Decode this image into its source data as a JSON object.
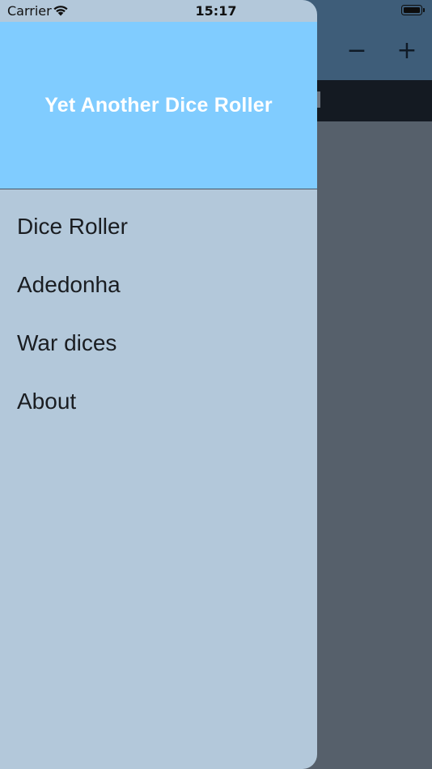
{
  "status_bar": {
    "carrier": "Carrier",
    "time": "15:17"
  },
  "background": {
    "minus_label": "−",
    "plus_label": "+"
  },
  "drawer": {
    "title": "Yet Another Dice Roller",
    "items": [
      {
        "label": "Dice Roller"
      },
      {
        "label": "Adedonha"
      },
      {
        "label": "War dices"
      },
      {
        "label": "About"
      }
    ]
  },
  "colors": {
    "header_bg": "#80ccff",
    "drawer_bg": "#b3c8da",
    "scrim": "#56606b",
    "appbar": "#3e5d79"
  }
}
